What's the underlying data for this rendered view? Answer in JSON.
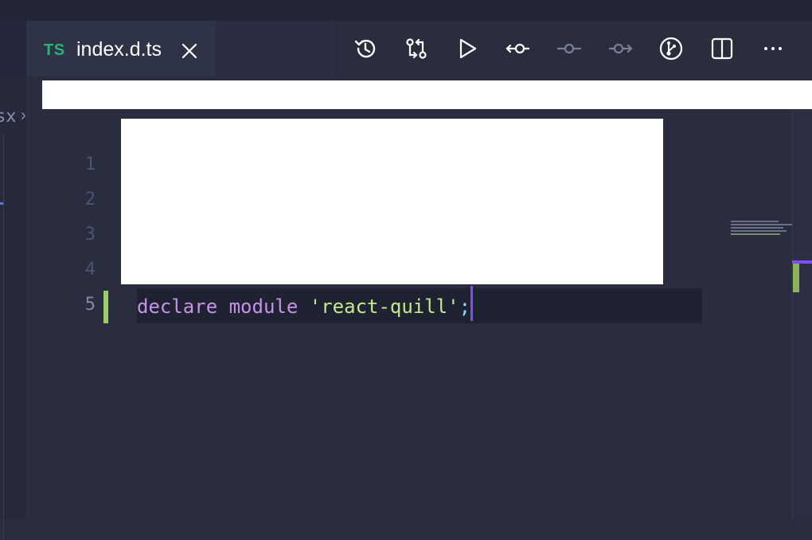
{
  "sidebar_fragment": {
    "crumb_text": "sx",
    "crumb_chevron": "›"
  },
  "tab": {
    "lang_badge": "TS",
    "filename": "index.d.ts",
    "close_icon": "close-icon"
  },
  "toolbar": {
    "icons": [
      "history-icon",
      "compare-changes-icon",
      "run-icon",
      "previous-change-icon",
      "commit-icon",
      "next-change-icon",
      "git-graph-icon",
      "split-editor-icon",
      "more-actions-icon"
    ]
  },
  "editor": {
    "line_numbers": [
      "1",
      "2",
      "3",
      "4",
      "5"
    ],
    "current_line": "5",
    "code_line_5": {
      "keyword1": "declare",
      "keyword2": "module",
      "string": "'react-quill'",
      "punct": ";"
    }
  },
  "colors": {
    "background": "#292d3e",
    "keyword": "#c792ea",
    "string": "#c3e88d",
    "ts_badge": "#2bb673",
    "git_added": "#9ccc65",
    "cursor": "#7c4dff"
  }
}
